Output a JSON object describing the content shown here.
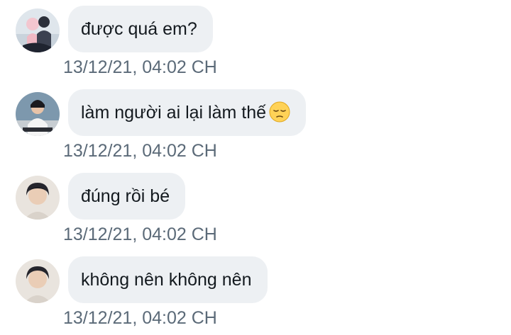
{
  "messages": [
    {
      "text": "được quá em?",
      "time": "13/12/21, 04:02 CH",
      "avatar": "avatar-couple-photo"
    },
    {
      "text": "làm người ai lại làm thế",
      "emoji": "pensive-face",
      "time": "13/12/21, 04:02 CH",
      "avatar": "avatar-seated-figure-photo"
    },
    {
      "text": "đúng rồi bé",
      "time": "13/12/21, 04:02 CH",
      "avatar": "avatar-portrait-photo"
    },
    {
      "text": "không nên không nên",
      "time": "13/12/21, 04:02 CH",
      "avatar": "avatar-portrait-photo"
    }
  ],
  "colors": {
    "bubble": "#edf0f3",
    "text": "#141a1f",
    "timestamp": "#5b6a78"
  }
}
